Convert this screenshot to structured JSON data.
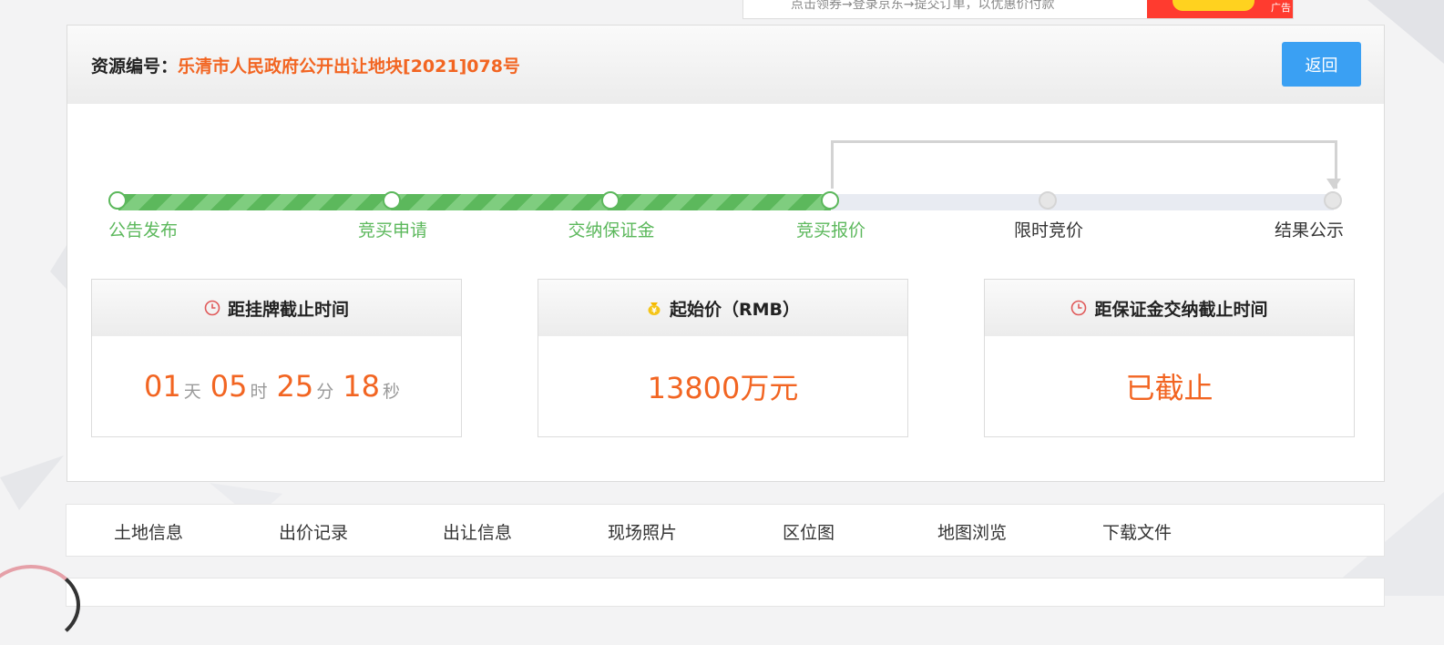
{
  "ad": {
    "text": "点击领券→登录京东→提交订单，以优惠价付款",
    "tag": "广告"
  },
  "header": {
    "label": "资源编号：",
    "resource_id": "乐清市人民政府公开出让地块[2021]078号",
    "back_button": "返回"
  },
  "progress": {
    "completed_color": "#5cb85c",
    "steps": [
      {
        "label": "公告发布",
        "status": "done"
      },
      {
        "label": "竞买申请",
        "status": "done"
      },
      {
        "label": "交纳保证金",
        "status": "done"
      },
      {
        "label": "竞买报价",
        "status": "done"
      },
      {
        "label": "限时竞价",
        "status": "todo"
      },
      {
        "label": "结果公示",
        "status": "todo"
      }
    ]
  },
  "boxes": {
    "listing_deadline": {
      "title": "距挂牌截止时间",
      "icon": "clock-icon",
      "days": "01",
      "days_unit": "天",
      "hours": "05",
      "hours_unit": "时",
      "minutes": "25",
      "minutes_unit": "分",
      "seconds": "18",
      "seconds_unit": "秒"
    },
    "start_price": {
      "title": "起始价（RMB）",
      "icon": "money-bag-icon",
      "value": "13800万元"
    },
    "deposit_deadline": {
      "title": "距保证金交纳截止时间",
      "icon": "clock-icon",
      "value": "已截止"
    }
  },
  "tabs": [
    "土地信息",
    "出价记录",
    "出让信息",
    "现场照片",
    "区位图",
    "地图浏览",
    "下载文件"
  ],
  "colors": {
    "accent_orange": "#f26522",
    "button_blue": "#3aa0f3",
    "step_green": "#5cb85c"
  }
}
